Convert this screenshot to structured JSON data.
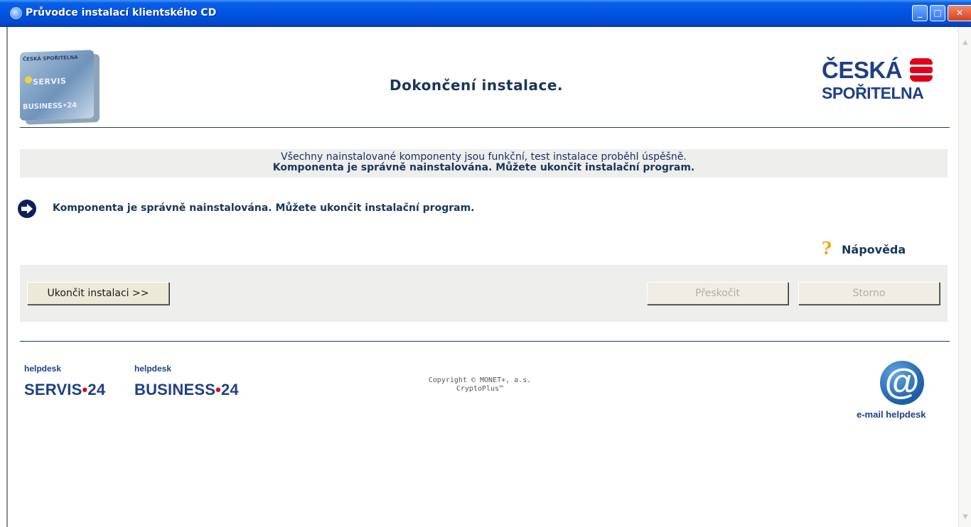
{
  "window": {
    "title": "Průvodce instalací klientského CD",
    "controls": {
      "minimize": "_",
      "maximize": "□",
      "close": "✕"
    }
  },
  "header": {
    "card_logo": {
      "brand": "ČESKÁ SPOŘITELNA",
      "servis": "SERVIS",
      "business": "BUSINESS•24"
    },
    "page_title": "Dokončení instalace.",
    "bank_logo": {
      "line1": "ČESKÁ",
      "line2": "SPOŘITELNA"
    }
  },
  "info_box": {
    "line1": "Všechny nainstalované komponenty jsou funkční, test instalace proběhl úspěšně.",
    "line2": "Komponenta je správně nainstalována. Můžete ukončit instalační program."
  },
  "status": {
    "icon": "arrow-right-icon",
    "text": "Komponenta je správně nainstalována. Můžete ukončit instalační program."
  },
  "help": {
    "icon": "question-icon",
    "label": "Nápověda"
  },
  "buttons": {
    "finish": "Ukončit instalaci >>",
    "skip": "Přeskočit",
    "cancel": "Storno"
  },
  "footer": {
    "servis": {
      "small": "helpdesk",
      "name": "SERVIS",
      "dot": "•",
      "num": "24"
    },
    "business": {
      "small": "helpdesk",
      "name": "BUSINESS",
      "dot": "•",
      "num": "24"
    },
    "copyright_line1": "Copyright © MONET+, a.s.",
    "copyright_line2": "CryptoPlus™",
    "email_label": "e-mail helpdesk"
  },
  "colors": {
    "brand_blue": "#1e3f87",
    "brand_red": "#e2001a",
    "title_blue": "#17365d",
    "panel_gray": "#eeeeec"
  }
}
